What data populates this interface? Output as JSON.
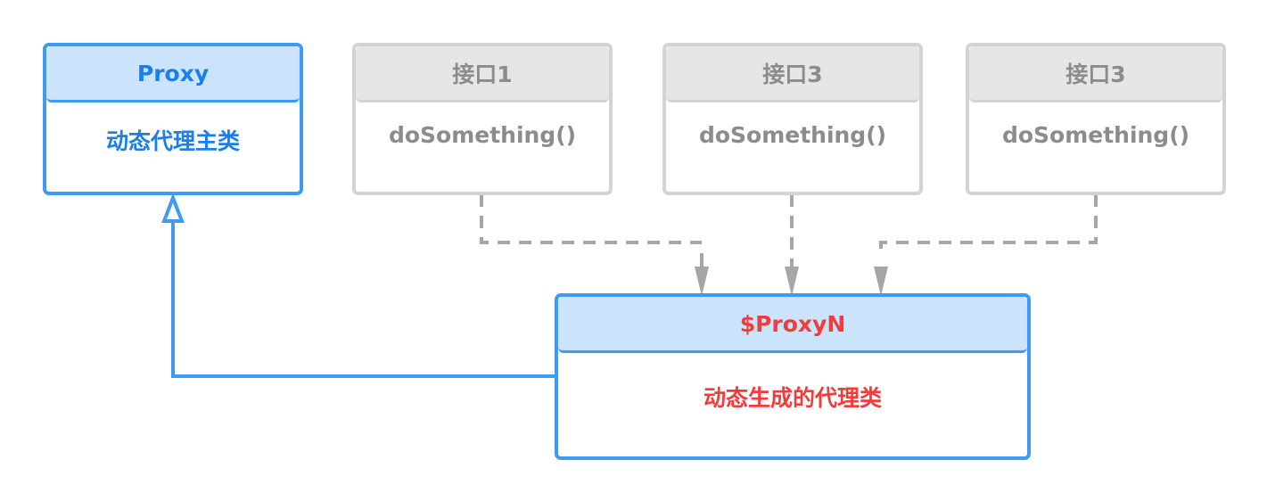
{
  "proxy_class": {
    "title": "Proxy",
    "description": "动态代理主类",
    "text_color": "#1a7fe8"
  },
  "interfaces": [
    {
      "title": "接口1",
      "method": "doSomething()"
    },
    {
      "title": "接口3",
      "method": "doSomething()"
    },
    {
      "title": "接口3",
      "method": "doSomething()"
    }
  ],
  "generated_class": {
    "title": "$ProxyN",
    "description": "动态生成的代理类",
    "text_color": "#f23c3c"
  },
  "relations": [
    {
      "from": "generated_class",
      "to": "proxy_class",
      "type": "inheritance"
    },
    {
      "from": "generated_class",
      "to": "interfaces.0",
      "type": "implementation"
    },
    {
      "from": "generated_class",
      "to": "interfaces.1",
      "type": "implementation"
    },
    {
      "from": "generated_class",
      "to": "interfaces.2",
      "type": "implementation"
    }
  ],
  "colors": {
    "blue_border": "#3d9bf5",
    "blue_header": "#cce4fb",
    "gray_border": "#d3d3d3",
    "gray_header": "#e6e6e6",
    "gray_text": "#8c8c8c",
    "arrow_gray": "#a6a6a6"
  }
}
